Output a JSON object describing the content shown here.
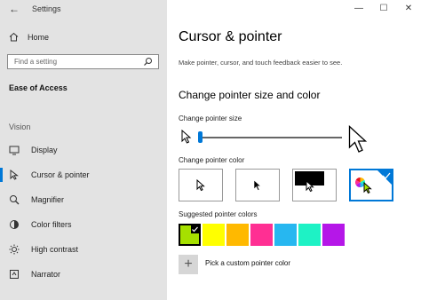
{
  "app": {
    "title": "Settings",
    "back_glyph": "←"
  },
  "window": {
    "minimize": "—",
    "maximize": "☐",
    "close": "✕"
  },
  "sidebar": {
    "home_label": "Home",
    "search_placeholder": "Find a setting",
    "section": "Ease of Access",
    "subheading": "Vision",
    "items": [
      {
        "label": "Display",
        "icon": "display-icon"
      },
      {
        "label": "Cursor & pointer",
        "icon": "cursor-icon",
        "selected": true
      },
      {
        "label": "Magnifier",
        "icon": "magnifier-icon"
      },
      {
        "label": "Color filters",
        "icon": "color-filter-icon"
      },
      {
        "label": "High contrast",
        "icon": "high-contrast-icon"
      },
      {
        "label": "Narrator",
        "icon": "narrator-icon"
      }
    ]
  },
  "main": {
    "title": "Cursor & pointer",
    "description": "Make pointer, cursor, and touch feedback easier to see.",
    "section_title": "Change pointer size and color",
    "size_label": "Change pointer size",
    "size_level": 0.0,
    "color_label": "Change pointer color",
    "color_options": [
      {
        "name": "white",
        "selected": false
      },
      {
        "name": "black",
        "selected": false
      },
      {
        "name": "inverted",
        "selected": false
      },
      {
        "name": "custom",
        "selected": true
      }
    ],
    "suggested_label": "Suggested pointer colors",
    "suggested_colors": [
      "#a6e000",
      "#ffff00",
      "#ffb900",
      "#ff2f93",
      "#27b7f0",
      "#1ef2c5",
      "#b517e8"
    ],
    "selected_color_index": 0,
    "custom_label": "Pick a custom pointer color",
    "accent": "#0078d7"
  }
}
